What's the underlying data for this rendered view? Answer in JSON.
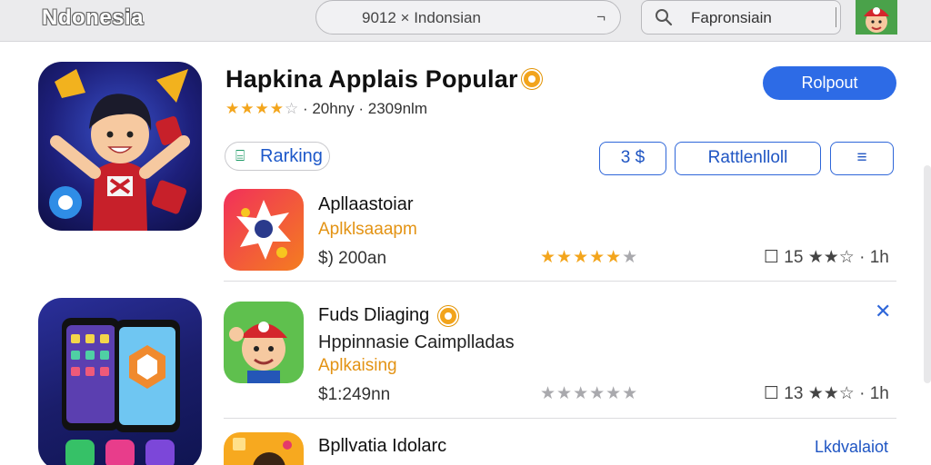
{
  "topbar": {
    "brand": "Ndonesia",
    "url_text": "9012 × Indonsian",
    "url_icon": "¬",
    "search_text": "Fapronsiain"
  },
  "featured": {
    "title": "Hapkina Applais Popular",
    "stars": "★★★★",
    "star_empty": "☆",
    "meta": "· 20hny · 2309nlm",
    "primary_button": "Rolpout"
  },
  "filters": {
    "ranking_label": "Rarking",
    "ranking_icon": "⌸",
    "button_a": "3 $",
    "button_b": "Rattlenlloll",
    "button_c": "≡"
  },
  "apps": [
    {
      "name": "Apllaastoiar",
      "category": "Aplklsaaapm",
      "price": "$) 200an",
      "stars_gold": "★★★★★",
      "stars_grey": "★",
      "rating_text": "☐ 15 ★★☆ · 1h"
    },
    {
      "name": "Fuds Dliaging",
      "subtitle": "Hppinnasie Caimplladas",
      "category": "Aplkaising",
      "price": "$1:249nn",
      "stars_grey": "★★★★★★",
      "rating_text": "☐ 13 ★★☆ · 1h",
      "close": "✕"
    },
    {
      "name": "Bpllvatia Idolarc",
      "link": "Lkdvalaiot"
    }
  ],
  "colors": {
    "accent": "#2d6be6",
    "star_gold": "#f3a51c",
    "category_orange": "#e39314"
  }
}
